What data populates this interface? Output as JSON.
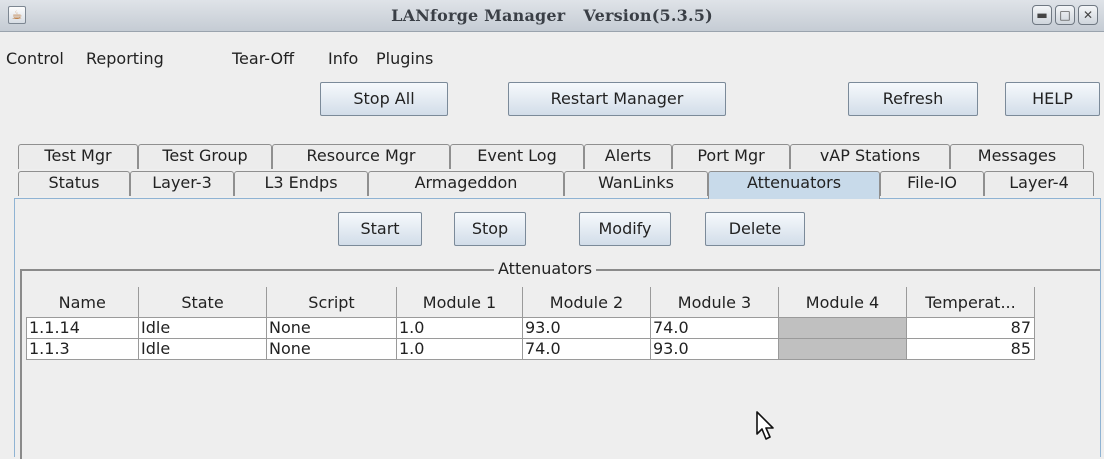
{
  "window": {
    "title_app": "LANforge Manager",
    "title_version": "Version(5.3.5)",
    "app_icon": "java-icon",
    "controls": [
      "minimize-icon",
      "maximize-icon",
      "close-icon"
    ]
  },
  "menu": {
    "items": [
      {
        "label": "Control"
      },
      {
        "label": "Reporting"
      },
      {
        "label": "Tear-Off"
      },
      {
        "label": "Info"
      },
      {
        "label": "Plugins"
      }
    ]
  },
  "toolbar": {
    "stop_all": "Stop All",
    "restart_manager": "Restart Manager",
    "refresh": "Refresh",
    "help": "HELP"
  },
  "tabs": {
    "row1": [
      "Test Mgr",
      "Test Group",
      "Resource Mgr",
      "Event Log",
      "Alerts",
      "Port Mgr",
      "vAP Stations",
      "Messages"
    ],
    "row2": [
      "Status",
      "Layer-3",
      "L3 Endps",
      "Armageddon",
      "WanLinks",
      "Attenuators",
      "File-IO",
      "Layer-4"
    ],
    "active": "Attenuators"
  },
  "panel": {
    "buttons": {
      "start": "Start",
      "stop": "Stop",
      "modify": "Modify",
      "delete": "Delete"
    },
    "group_title": "Attenuators",
    "table": {
      "columns": [
        "Name",
        "State",
        "Script",
        "Module 1",
        "Module 2",
        "Module 3",
        "Module 4",
        "Temperat..."
      ],
      "rows": [
        [
          "1.1.14",
          "Idle",
          "None",
          "1.0",
          "93.0",
          "74.0",
          "",
          "87"
        ],
        [
          "1.1.3",
          "Idle",
          "None",
          "1.0",
          "74.0",
          "93.0",
          "",
          "85"
        ]
      ]
    }
  },
  "colors": {
    "active_tab": "#c8daea",
    "button_gradient_top": "#f6f9fc",
    "button_gradient_bottom": "#d2dde9",
    "empty_cell": "#c0c0c0"
  }
}
